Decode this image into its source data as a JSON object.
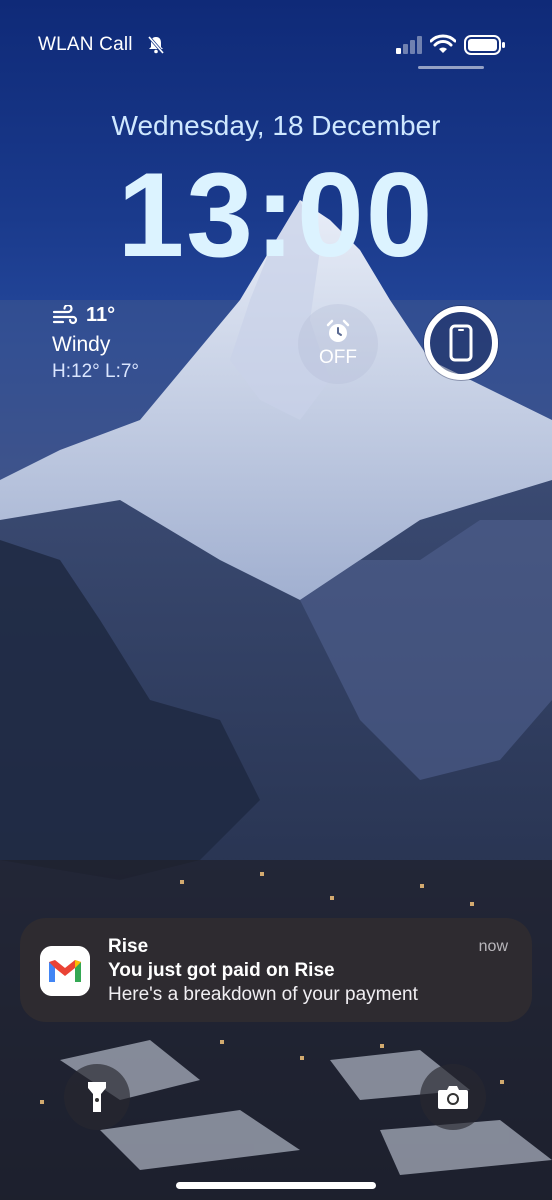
{
  "status_bar": {
    "carrier": "WLAN Call"
  },
  "lock_screen": {
    "date": "Wednesday, 18 December",
    "time": "13:00"
  },
  "weather": {
    "temperature": "11°",
    "condition": "Windy",
    "high_low": "H:12° L:7°"
  },
  "alarm_widget": {
    "label": "OFF"
  },
  "battery_widget": {
    "level_fraction": 1.0
  },
  "notification": {
    "app": "Rise",
    "time": "now",
    "title": "You just got paid on Rise",
    "body": "Here's a breakdown of your payment",
    "icon": "gmail-icon"
  },
  "quick_actions": {
    "left": "flashlight-icon",
    "right": "camera-icon"
  },
  "colors": {
    "accent": "#dcf3ff",
    "notification_bg": "#302c30"
  }
}
